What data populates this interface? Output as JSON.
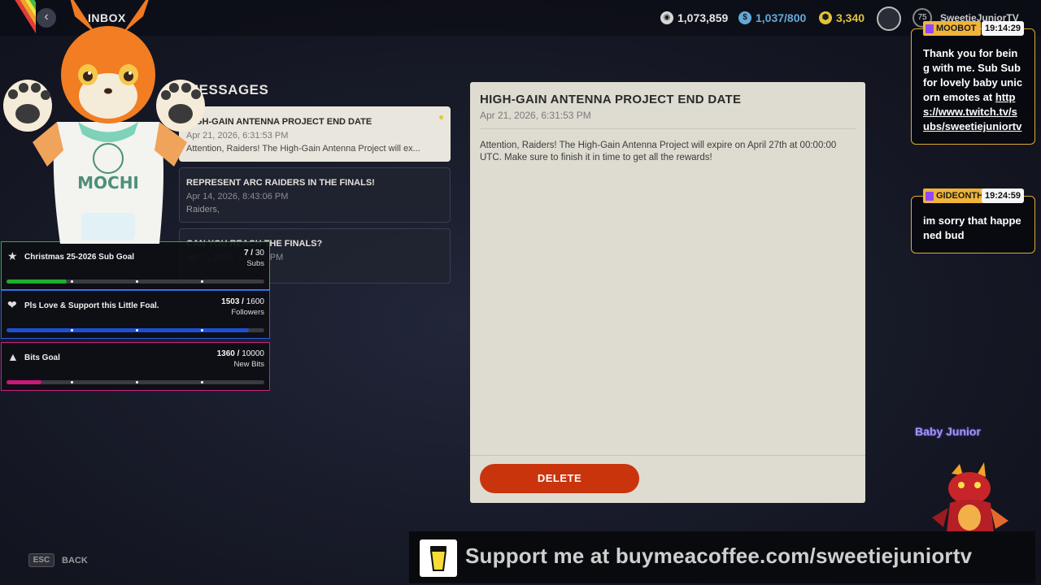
{
  "header": {
    "title": "INBOX",
    "back_arrow": "‹",
    "currencies": [
      {
        "name": "coins-icon",
        "value": "1,073,859",
        "color": "#d7d7d7"
      },
      {
        "name": "cred-icon",
        "value": "1,037/800",
        "color": "#63a9d8"
      },
      {
        "name": "raider-tokens-icon",
        "value": "3,340",
        "color": "#e2c23a"
      }
    ],
    "level": "75",
    "username": "SweetieJuniorTV"
  },
  "messages": {
    "heading": "MESSAGES",
    "items": [
      {
        "title": "HIGH-GAIN ANTENNA PROJECT END DATE",
        "date": "Apr 21, 2026, 6:31:53 PM",
        "preview": "Attention, Raiders! The High-Gain Antenna Project will ex..."
      },
      {
        "title": "REPRESENT ARC RAIDERS IN THE FINALS!",
        "date": "Apr 14, 2026, 8:43:06 PM",
        "preview": "Raiders,"
      },
      {
        "title": "CAN YOU REACH THE FINALS?",
        "date": "Apr 7, 2026, 5:51:36 PM",
        "preview": ""
      }
    ]
  },
  "detail": {
    "title": "HIGH-GAIN ANTENNA PROJECT END DATE",
    "date": "Apr 21, 2026, 6:31:53 PM",
    "body": "Attention, Raiders! The High-Gain Antenna Project will expire on April 27th at 00:00:00 UTC. Make sure to finish it in time to get all the rewards!",
    "delete_label": "DELETE"
  },
  "footer": {
    "esc_key": "ESC",
    "back_label": "BACK"
  },
  "goals": [
    {
      "icon": "star-icon",
      "glyph": "★",
      "title": "Christmas 25-2026 Sub Goal",
      "current": "7",
      "target": "30",
      "unit": "Subs",
      "progress": 0.233,
      "color": "#1fae2f",
      "border": "#23b636"
    },
    {
      "icon": "hearts-icon",
      "glyph": "❤",
      "title": "Pls Love & Support this Little Foal.",
      "current": "1503",
      "target": "1600",
      "unit": "Followers",
      "progress": 0.939,
      "color": "#1f4fd0",
      "border": "#2b5fe0"
    },
    {
      "icon": "bits-icon",
      "glyph": "▲",
      "title": "Bits Goal",
      "current": "1360",
      "target": "10000",
      "unit": "New Bits",
      "progress": 0.136,
      "color": "#c9187a",
      "border": "#cc1f83"
    }
  ],
  "chat": [
    {
      "user": "MOOBOT",
      "time": "19:14:29",
      "text": "Thank you for being with me. Sub Sub for lovely baby unicorn emotes at ",
      "link": "https://www.twitch.tv/subs/sweetiejuniortv"
    },
    {
      "user": "GIDEONTHI",
      "time": "19:24:59",
      "text": "im sorry that happened bud",
      "link": ""
    }
  ],
  "pet_name": "Baby Junior",
  "banner_text": "Support me at buymeacoffee.com/sweetiejuniortv"
}
